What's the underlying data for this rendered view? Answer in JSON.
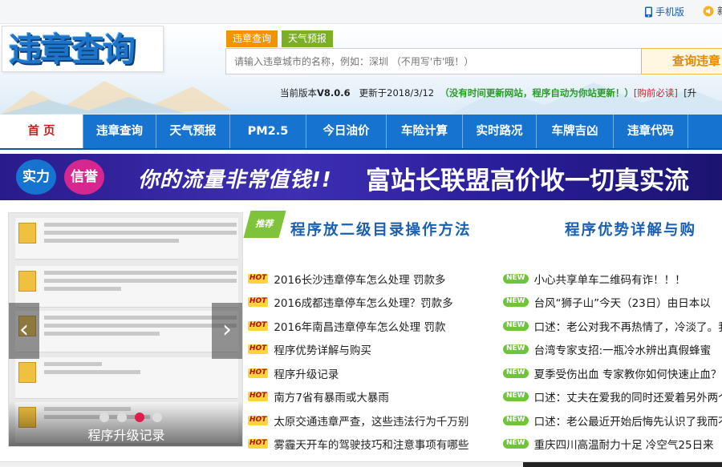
{
  "topbar": {
    "mobile_label": "手机版",
    "notice_label": "新"
  },
  "header": {
    "logo": "违章查询",
    "tabs": [
      "违章查询",
      "天气预报"
    ],
    "search_placeholder": "请输入违章城市的名称，例如：深圳 （不用写'市'哦！）",
    "search_button": "查询违章",
    "version_prefix": "当前版本",
    "version": "V8.0.6",
    "updated_prefix": "更新于",
    "updated_date": "2018/3/12",
    "update_note": "（没有时间更新网站，程序自动为你站更新！）",
    "must_read": "[购前必读]",
    "trailing": "[升"
  },
  "nav": {
    "items": [
      "首  页",
      "违章查询",
      "天气预报",
      "PM2.5",
      "今日油价",
      "车险计算",
      "实时路况",
      "车牌吉凶",
      "违章代码"
    ],
    "active_index": 0
  },
  "banner": {
    "badge1": "实力",
    "badge2": "信誉",
    "slogan": "你的流量非常值钱!!",
    "slogan2": "富站长联盟高价收一切真实流"
  },
  "slider": {
    "caption": "程序升级记录",
    "dots": 4,
    "active_dot": 2,
    "prev_label": "‹",
    "next_label": "›"
  },
  "headline": {
    "tag": "推荐",
    "title1": "程序放二级目录操作方法",
    "title2": "程序优势详解与购"
  },
  "hot_list": {
    "badge": "HOT",
    "items": [
      "2016长沙违章停车怎么处理 罚款多",
      "2016成都违章停车怎么处理？罚款多",
      "2016年南昌违章停车怎么处理 罚款",
      "程序优势详解与购买",
      "程序升级记录",
      "南方7省有暴雨或大暴雨",
      "太原交通违章严查，这些违法行为千万别",
      "雾霾天开车的驾驶技巧和注意事项有哪些"
    ]
  },
  "new_list": {
    "badge": "NEW",
    "items": [
      "小心共享单车二维码有诈！！！",
      "台风“狮子山”今天（23日）由日本以",
      "口述：老公对我不再热情了，冷淡了。我",
      "台湾专家支招:一瓶冷水辨出真假蜂蜜",
      "夏季受伤出血 专家教你如何快速止血？",
      "口述：丈夫在爱我的同时还爱着另外两个",
      "口述：老公最近开始后悔先认识了我而不",
      "重庆四川高温耐力十足 冷空气25日来"
    ]
  },
  "colors": {
    "nav_blue": "#1673cf",
    "active_red": "#cc1b1b",
    "tab_orange": "#f29400",
    "tab_green": "#7cae28",
    "banner_purple": "#2a1b8c"
  }
}
